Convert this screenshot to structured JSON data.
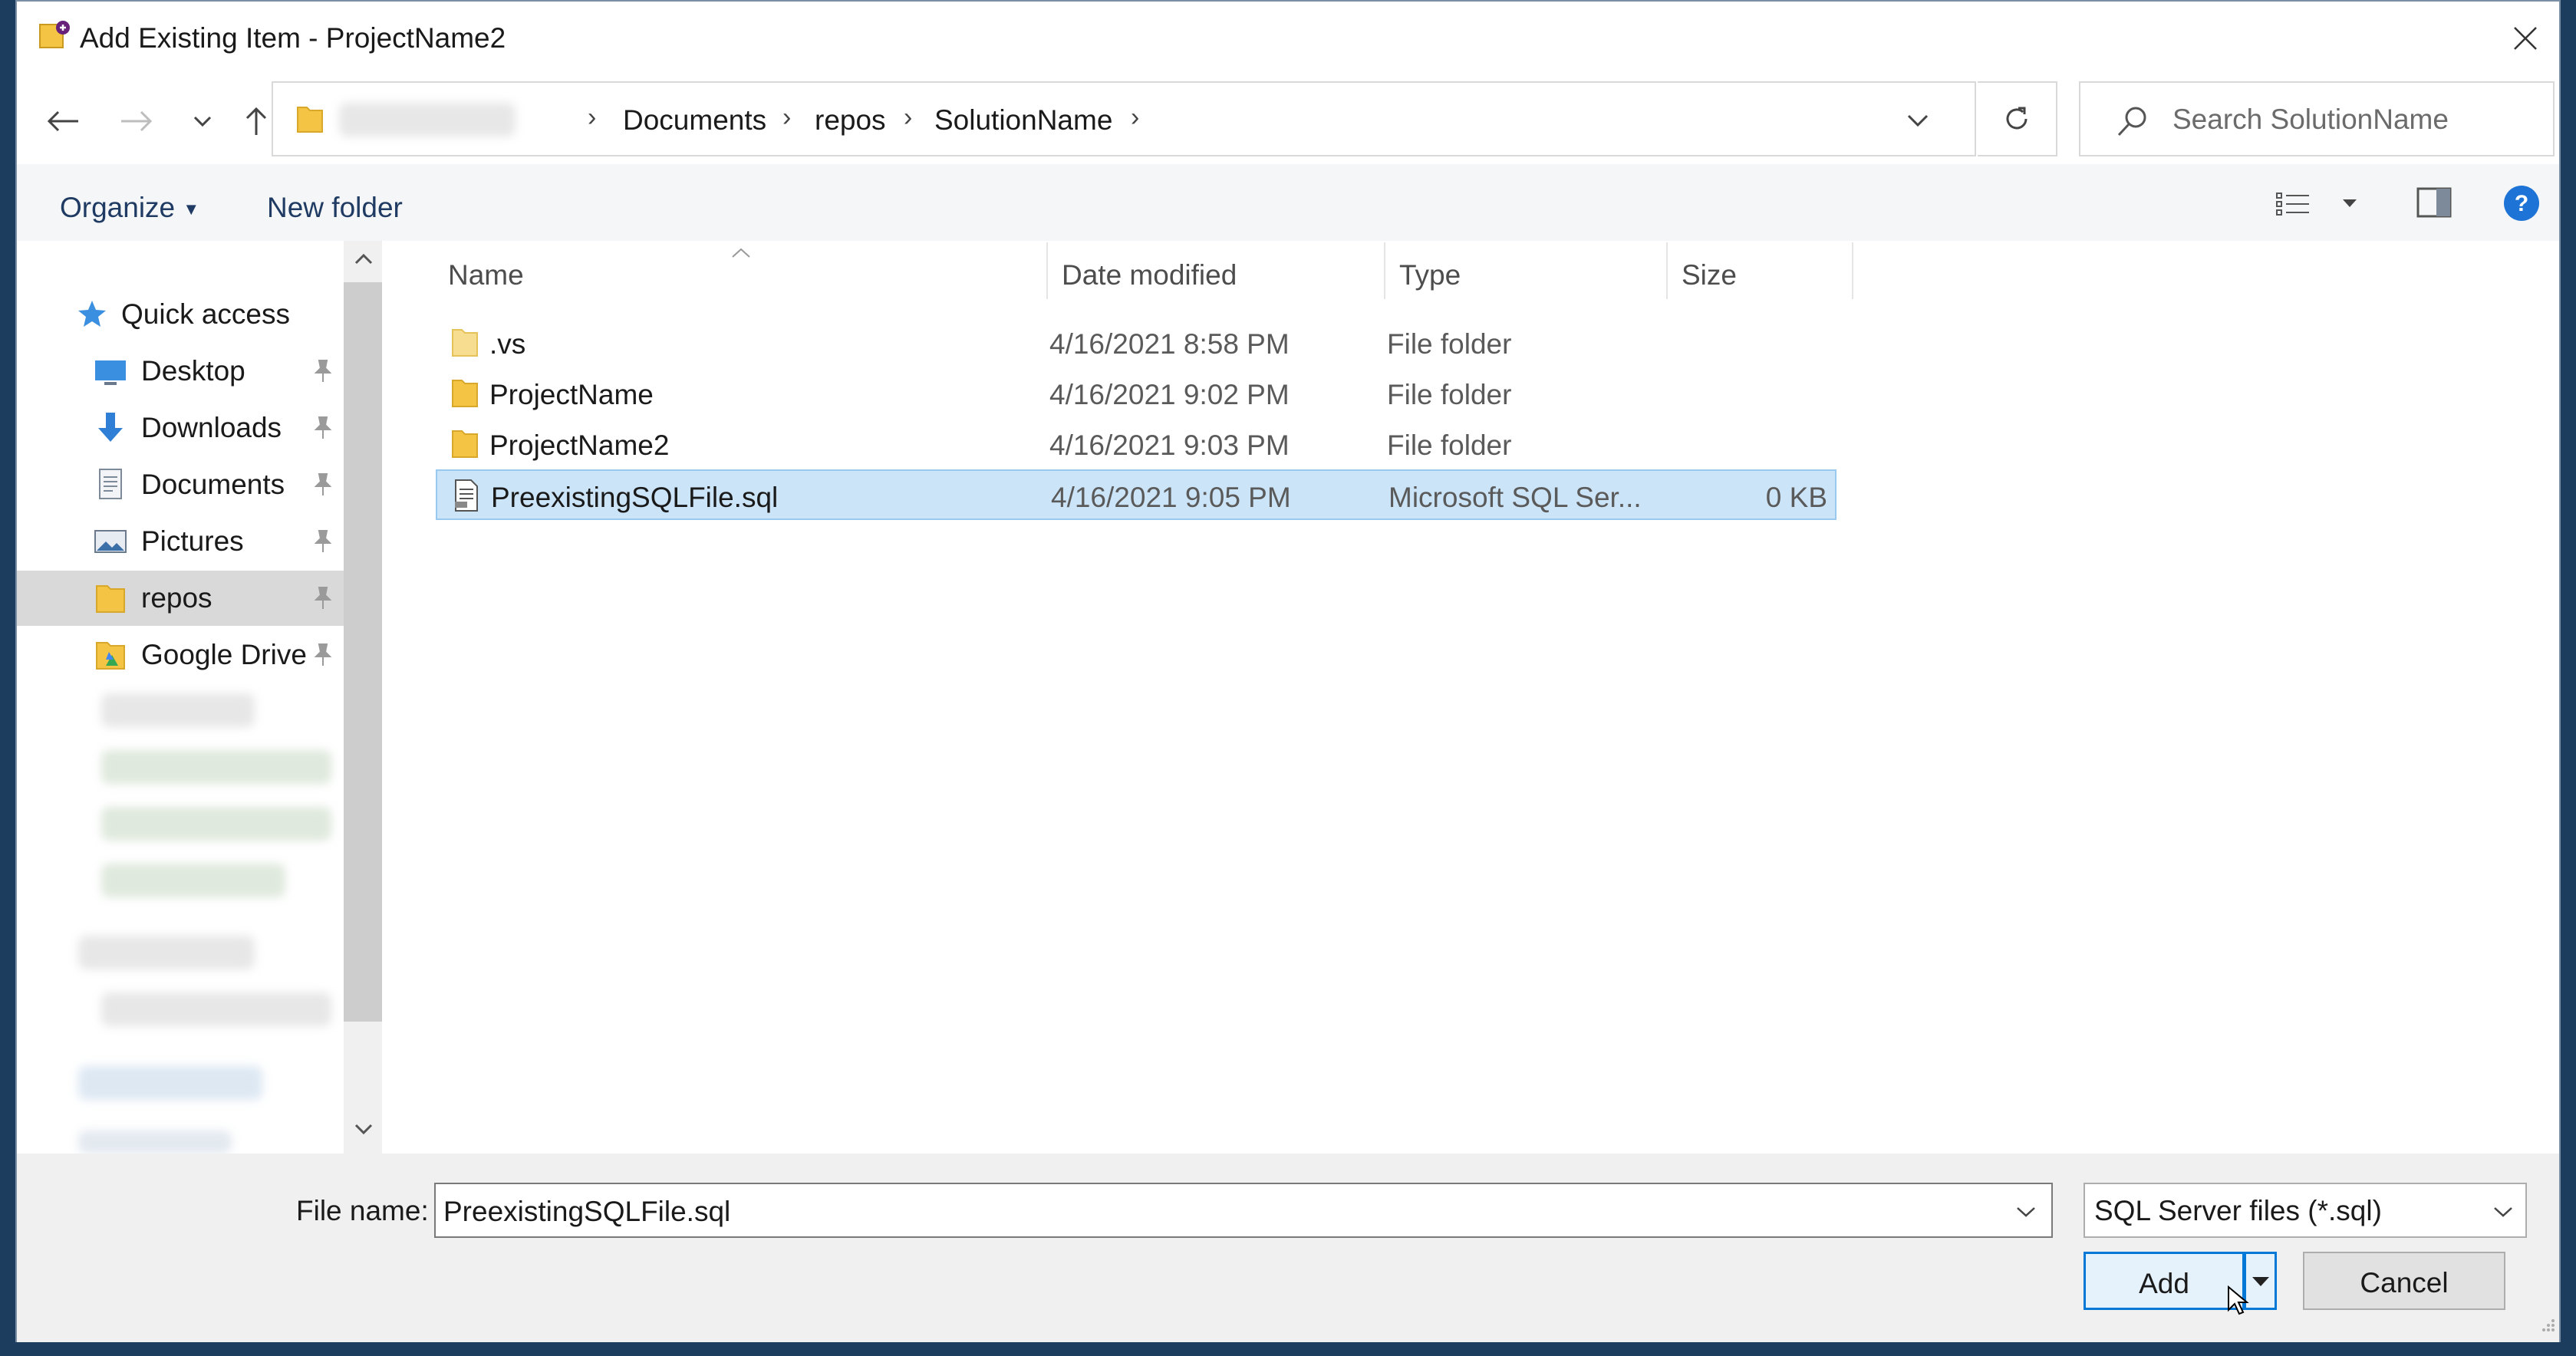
{
  "window": {
    "title": "Add Existing Item - ProjectName2"
  },
  "address": {
    "crumbs": [
      "Documents",
      "repos",
      "SolutionName"
    ]
  },
  "search": {
    "placeholder": "Search SolutionName"
  },
  "toolbar": {
    "organize_label": "Organize",
    "new_folder_label": "New folder"
  },
  "nav": {
    "quick_access": "Quick access",
    "items": [
      {
        "label": "Desktop",
        "icon": "desktop-icon"
      },
      {
        "label": "Downloads",
        "icon": "download-arrow-icon"
      },
      {
        "label": "Documents",
        "icon": "documents-icon"
      },
      {
        "label": "Pictures",
        "icon": "pictures-icon"
      },
      {
        "label": "repos",
        "icon": "folder-icon"
      },
      {
        "label": "Google Drive",
        "icon": "google-drive-icon"
      }
    ],
    "selected": "repos"
  },
  "columns": {
    "name": "Name",
    "date": "Date modified",
    "type": "Type",
    "size": "Size"
  },
  "files": [
    {
      "name": ".vs",
      "date": "4/16/2021 8:58 PM",
      "type": "File folder",
      "size": ""
    },
    {
      "name": "ProjectName",
      "date": "4/16/2021 9:02 PM",
      "type": "File folder",
      "size": ""
    },
    {
      "name": "ProjectName2",
      "date": "4/16/2021 9:03 PM",
      "type": "File folder",
      "size": ""
    },
    {
      "name": "PreexistingSQLFile.sql",
      "date": "4/16/2021 9:05 PM",
      "type": "Microsoft SQL Ser...",
      "size": "0 KB"
    }
  ],
  "bottom": {
    "file_name_label": "File name:",
    "file_name_value": "PreexistingSQLFile.sql",
    "filter_value": "SQL Server files (*.sql)",
    "add_label": "Add",
    "cancel_label": "Cancel"
  },
  "colors": {
    "accent": "#0078d7",
    "selection": "#cce4f7",
    "folder": "#f4c545",
    "help": "#1e73d6"
  }
}
